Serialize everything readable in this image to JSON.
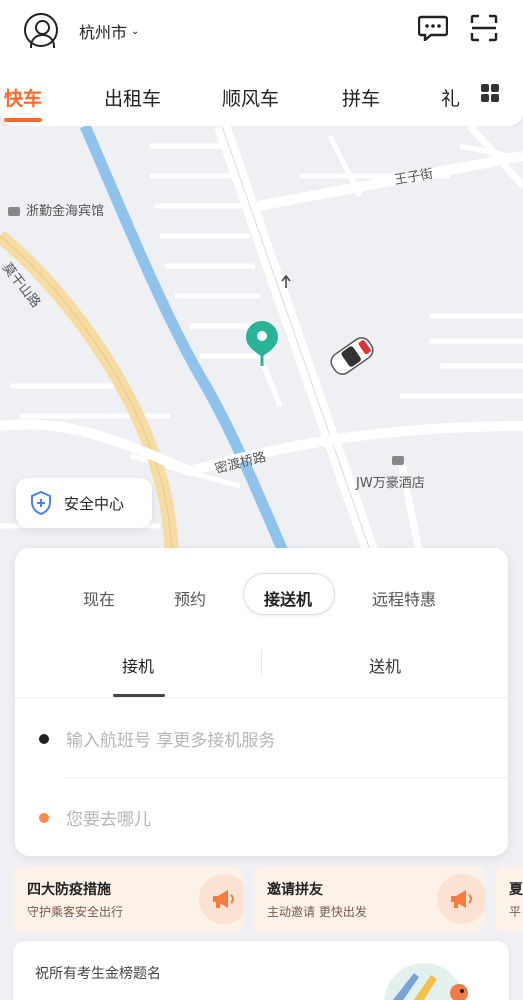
{
  "header": {
    "city": "杭州市"
  },
  "tabs": {
    "items": [
      "快车",
      "出租车",
      "顺风车",
      "拼车",
      "礼"
    ]
  },
  "map": {
    "labels": {
      "hotel_1": "浙勤金海宾馆",
      "street_1": "王子街",
      "road_1": "莫干山路",
      "road_2": "密渡桥路",
      "hotel_2": "JW万豪酒店"
    }
  },
  "safety": {
    "label": "安全中心"
  },
  "booking": {
    "modes": [
      "现在",
      "预约",
      "接送机",
      "远程特惠"
    ],
    "active_mode": "接送机",
    "sub_tabs": [
      "接机",
      "送机"
    ],
    "flight_placeholder": "输入航班号 享更多接机服务",
    "destination_placeholder": "您要去哪儿"
  },
  "promos": [
    {
      "title": "四大防疫措施",
      "subtitle": "守护乘客安全出行"
    },
    {
      "title": "邀请拼友",
      "subtitle": "主动邀请 更快出发"
    },
    {
      "title": "夏",
      "subtitle": "平"
    }
  ],
  "banner": {
    "text": "祝所有考生金榜题名"
  },
  "colors": {
    "accent": "#ff6a2a",
    "pin": "#2bb39a",
    "river": "#8fc3ec",
    "road_major": "#f6dca2"
  }
}
